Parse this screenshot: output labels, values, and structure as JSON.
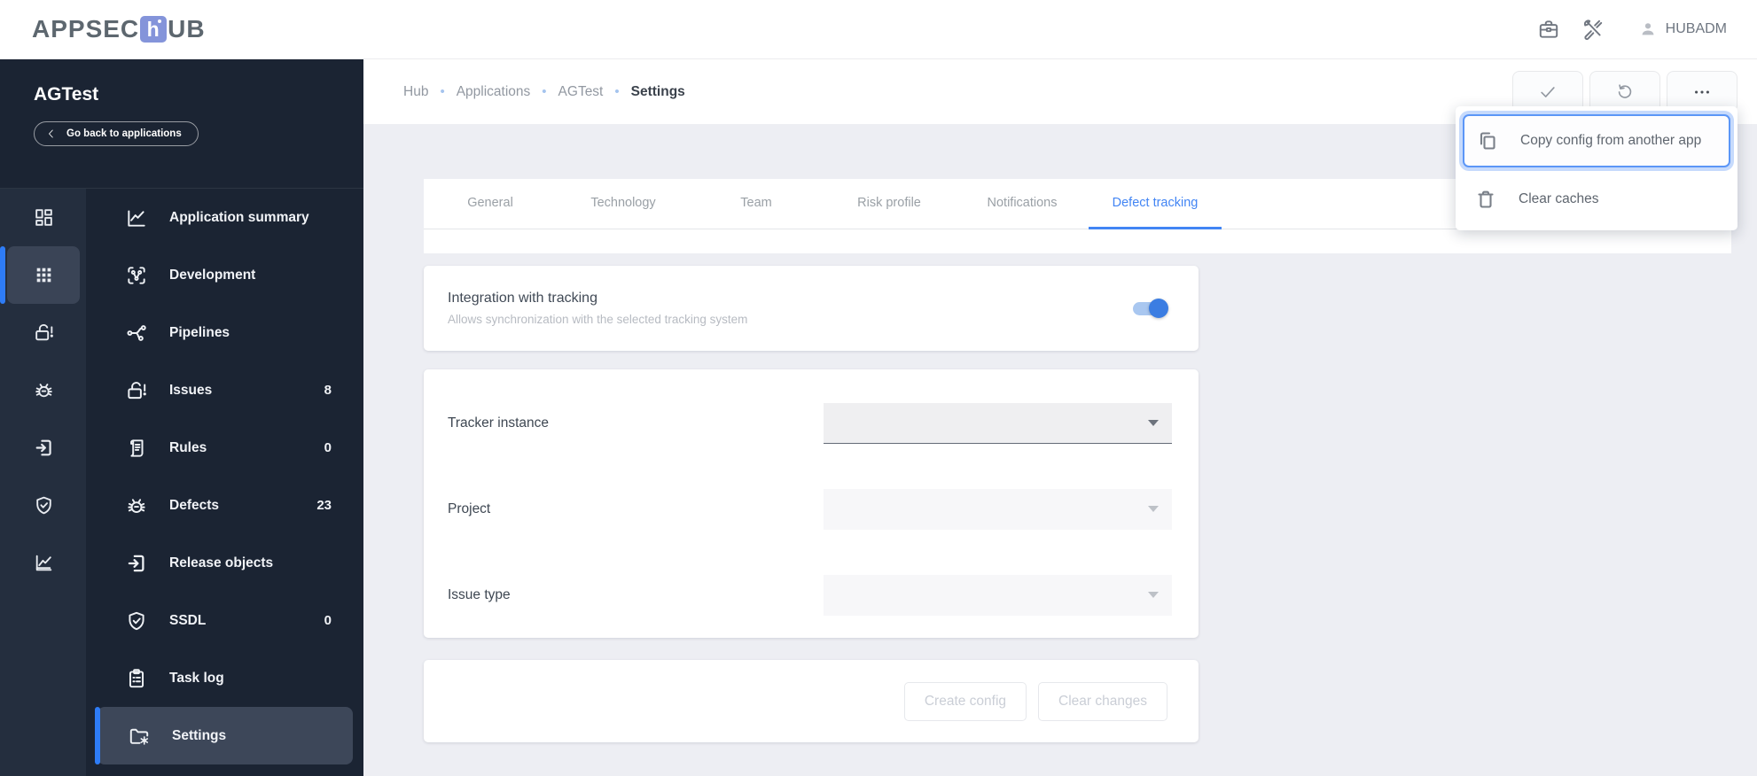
{
  "app": {
    "logo_part1": "APPSEC",
    "logo_mid": "h",
    "logo_part2": "UB",
    "user": "HUBADM"
  },
  "sidebar": {
    "title": "AGTest",
    "back_label": "Go back to applications",
    "menu": [
      {
        "label": "Application summary",
        "badge": ""
      },
      {
        "label": "Development",
        "badge": ""
      },
      {
        "label": "Pipelines",
        "badge": ""
      },
      {
        "label": "Issues",
        "badge": "8"
      },
      {
        "label": "Rules",
        "badge": "0"
      },
      {
        "label": "Defects",
        "badge": "23"
      },
      {
        "label": "Release objects",
        "badge": ""
      },
      {
        "label": "SSDL",
        "badge": "0"
      },
      {
        "label": "Task log",
        "badge": ""
      },
      {
        "label": "Settings",
        "badge": ""
      }
    ]
  },
  "breadcrumb": {
    "items": [
      "Hub",
      "Applications",
      "AGTest"
    ],
    "current": "Settings"
  },
  "popup": {
    "items": [
      {
        "label": "Copy config from another app"
      },
      {
        "label": "Clear caches"
      }
    ]
  },
  "tabs": [
    {
      "label": "General"
    },
    {
      "label": "Technology"
    },
    {
      "label": "Team"
    },
    {
      "label": "Risk profile"
    },
    {
      "label": "Notifications"
    },
    {
      "label": "Defect tracking"
    }
  ],
  "content": {
    "integration": {
      "title": "Integration with tracking",
      "subtitle": "Allows synchronization with the selected tracking system",
      "toggle_state": "on"
    },
    "fields": [
      {
        "label": "Tracker instance",
        "value": ""
      },
      {
        "label": "Project",
        "value": ""
      },
      {
        "label": "Issue type",
        "value": ""
      }
    ],
    "buttons": {
      "create": "Create config",
      "clear": "Clear changes"
    }
  },
  "colors": {
    "accent_blue": "#2e7cf6",
    "tab_active_blue": "#4285f4",
    "sidebar_bg": "#1b2433",
    "rail_bg": "#242e3e",
    "active_item_bg": "#3d4759",
    "toggle_on": "#3b7de2",
    "logo_block": "#8494da"
  }
}
